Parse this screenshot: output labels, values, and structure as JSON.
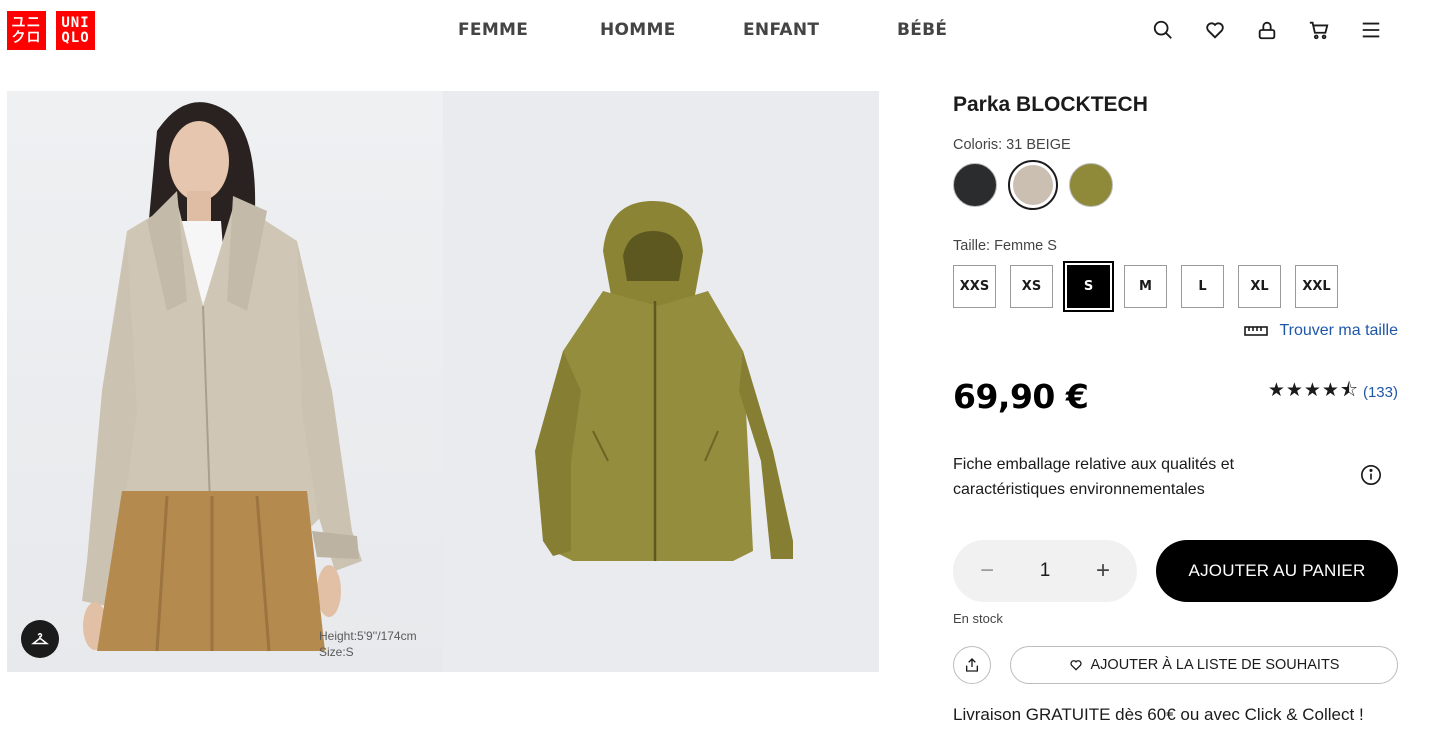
{
  "brand": {
    "logo_left": [
      "ユニ",
      "クロ"
    ],
    "logo_right": [
      "UNI",
      "QLO"
    ],
    "brand_color": "#ff0000"
  },
  "nav": {
    "items": [
      "FEMME",
      "HOMME",
      "ENFANT",
      "BÉBÉ"
    ]
  },
  "header_icons": [
    "search-icon",
    "heart-icon",
    "account-icon",
    "cart-icon",
    "menu-icon"
  ],
  "gallery": {
    "model_height": "Height:5'9''/174cm",
    "model_size": "Size:S"
  },
  "product": {
    "title": "Parka BLOCKTECH",
    "color_label": "Coloris: 31 BEIGE",
    "colors": [
      {
        "name": "black",
        "hex": "#2b2c2e",
        "selected": false
      },
      {
        "name": "beige",
        "hex": "#cbbfb2",
        "selected": true
      },
      {
        "name": "olive",
        "hex": "#8f8a3a",
        "selected": false
      }
    ],
    "size_label": "Taille: Femme S",
    "sizes": [
      "XXS",
      "XS",
      "S",
      "M",
      "L",
      "XL",
      "XXL"
    ],
    "selected_size": "S",
    "find_size": "Trouver ma taille",
    "price": "69,90 €",
    "rating_stars": "★★★★⯪",
    "rating_value": 4.5,
    "review_count": "(133)",
    "fiche_text": "Fiche emballage relative aux qualités et caractéristiques environnementales",
    "quantity": "1",
    "add_to_cart": "AJOUTER AU PANIER",
    "stock_status": "En stock",
    "wishlist": "AJOUTER À LA LISTE DE SOUHAITS",
    "shipping": "Livraison GRATUITE dès 60€ ou avec Click & Collect !"
  }
}
